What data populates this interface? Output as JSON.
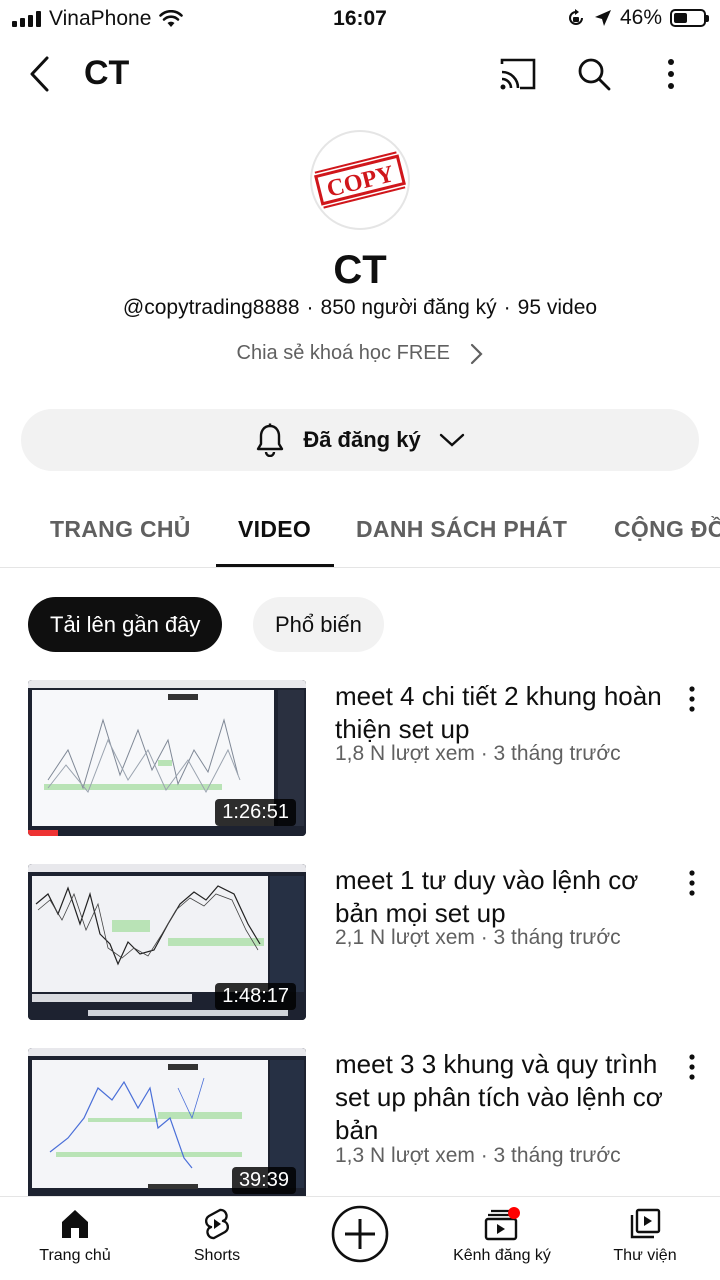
{
  "status": {
    "carrier": "VinaPhone",
    "time": "16:07",
    "battery": "46%",
    "battery_level": 0.46
  },
  "appbar": {
    "title": "CT"
  },
  "channel": {
    "logo_text": "COPY",
    "name": "CT",
    "handle": "@copytrading8888",
    "subscribers": "850 người đăng ký",
    "video_count": "95 video",
    "description": "Chia sẻ khoá học FREE",
    "subscribe_label": "Đã đăng ký"
  },
  "tabs": [
    {
      "label": "TRANG CHỦ"
    },
    {
      "label": "VIDEO"
    },
    {
      "label": "DANH SÁCH PHÁT"
    },
    {
      "label": "CỘNG ĐỒNG"
    }
  ],
  "chips": [
    {
      "label": "Tải lên gần đây"
    },
    {
      "label": "Phổ biến"
    }
  ],
  "videos": [
    {
      "title": "meet 4 chi tiết 2 khung hoàn thiện set up",
      "views": "1,8 N lượt xem",
      "age": "3 tháng trước",
      "duration": "1:26:51"
    },
    {
      "title": "meet 1 tư duy vào lệnh cơ bản mọi set up",
      "views": "2,1 N lượt xem",
      "age": "3 tháng trước",
      "duration": "1:48:17"
    },
    {
      "title": "meet 3 3 khung và quy trình set up phân tích vào lệnh cơ bản",
      "views": "1,3 N lượt xem",
      "age": "3 tháng trước",
      "duration": "39:39"
    }
  ],
  "bottom_nav": [
    {
      "label": "Trang chủ",
      "icon": "home-icon"
    },
    {
      "label": "Shorts",
      "icon": "shorts-icon"
    },
    {
      "label": "",
      "icon": "create-icon"
    },
    {
      "label": "Kênh đăng ký",
      "icon": "subscriptions-icon"
    },
    {
      "label": "Thư viện",
      "icon": "library-icon"
    }
  ],
  "colors": {
    "text": "#0f0f0f",
    "secondary": "#606060",
    "chip_bg": "#f2f2f2",
    "logo_red": "#d0161b",
    "notification_dot": "#ff0000"
  }
}
